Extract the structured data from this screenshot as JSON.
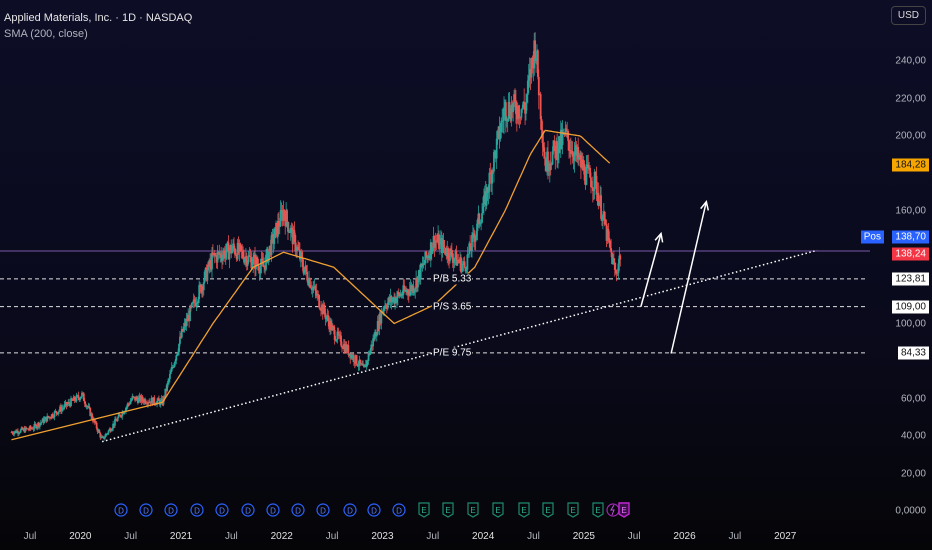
{
  "header": {
    "title": "Applied Materials, Inc. · 1D · NASDAQ",
    "indicator": "SMA (200, close)",
    "currency": "USD"
  },
  "colors": {
    "up": "#26a69a",
    "down": "#ef5350",
    "sma": "#f0a030",
    "pos": "#2962ff",
    "last": "#f23645",
    "smaTag": "#f7a600"
  },
  "y_axis": {
    "ticks": [
      "240,00",
      "220,00",
      "200,00",
      "160,00",
      "100,00",
      "60,00",
      "40,00",
      "20,00",
      "0,0000"
    ]
  },
  "price_tags": {
    "sma": "184,28",
    "pos_label": "Pos",
    "pos": "138,70",
    "last": "138,24",
    "pb": "123,81",
    "ps": "109,00",
    "pe": "84,33"
  },
  "levels": {
    "pb": "P/B 5.33",
    "ps": "P/S 3.65",
    "pe": "P/E 9.75"
  },
  "x_axis": {
    "ticks": [
      "Jul",
      "2020",
      "Jul",
      "2021",
      "Jul",
      "2022",
      "Jul",
      "2023",
      "Jul",
      "2024",
      "Jul",
      "2025",
      "Jul",
      "2026",
      "Jul",
      "2027"
    ]
  },
  "events": {
    "dividend": "D",
    "earnings": "E"
  },
  "chart_data": {
    "type": "candlestick",
    "title": "Applied Materials, Inc. · 1D · NASDAQ",
    "ylim": [
      0,
      260
    ],
    "xlim": [
      2019.3,
      2027.5
    ],
    "price": {
      "t": [
        2019.3,
        2019.5,
        2020.0,
        2020.2,
        2020.5,
        2020.8,
        2021.0,
        2021.3,
        2021.5,
        2021.8,
        2022.0,
        2022.2,
        2022.5,
        2022.8,
        2023.0,
        2023.3,
        2023.5,
        2023.8,
        2024.0,
        2024.2,
        2024.4,
        2024.5,
        2024.6,
        2024.8,
        2025.0,
        2025.1,
        2025.2,
        2025.3,
        2025.35
      ],
      "v": [
        42,
        44,
        62,
        38,
        60,
        58,
        96,
        135,
        140,
        130,
        160,
        130,
        95,
        75,
        110,
        120,
        145,
        130,
        165,
        215,
        215,
        250,
        185,
        200,
        180,
        175,
        150,
        126,
        138
      ]
    },
    "sma200": {
      "t": [
        2019.3,
        2020.2,
        2020.8,
        2021.3,
        2021.7,
        2022.0,
        2022.5,
        2022.9,
        2023.1,
        2023.5,
        2023.9,
        2024.2,
        2024.45,
        2024.6,
        2024.95,
        2025.25
      ],
      "v": [
        38,
        50,
        58,
        100,
        130,
        138,
        130,
        110,
        100,
        110,
        130,
        160,
        190,
        203,
        200,
        185
      ]
    },
    "trendline": {
      "t": [
        2020.2,
        2027.3
      ],
      "v": [
        37,
        139
      ]
    },
    "levels": [
      123.81,
      109.0,
      84.33
    ],
    "last_price": 138.24,
    "arrows": [
      {
        "t": [
          2025.55,
          2025.75
        ],
        "v": [
          109,
          148
        ]
      },
      {
        "t": [
          2025.85,
          2026.2
        ],
        "v": [
          84,
          165
        ]
      }
    ]
  }
}
